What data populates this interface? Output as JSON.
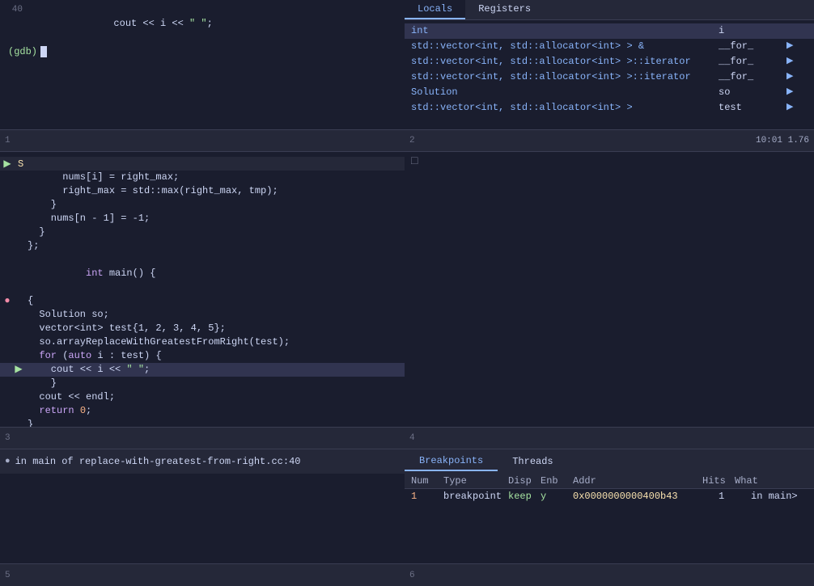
{
  "tabs": {
    "locals_label": "Locals",
    "registers_label": "Registers",
    "breakpoints_label": "Breakpoints",
    "threads_label": "Threads"
  },
  "top_left": {
    "lines": [
      {
        "num": "40",
        "content": "    cout << i << \" \";"
      },
      {
        "num": "",
        "content": "(gdb) "
      }
    ]
  },
  "locals": {
    "rows": [
      {
        "type": "int",
        "name": "i",
        "selected": true
      },
      {
        "type": "std::vector<int, std::allocator<int> > &",
        "name": "__for_"
      },
      {
        "type": "std::vector<int, std::allocator<int> >::iterator",
        "name": "__for_"
      },
      {
        "type": "std::vector<int, std::allocator<int> >::iterator",
        "name": "__for_"
      },
      {
        "type": "Solution",
        "name": "so"
      },
      {
        "type": "std::vector<int, std::allocator<int> >",
        "name": "test"
      }
    ]
  },
  "divider1": {
    "left_num": "1",
    "right_num": "2",
    "right_info": "10:01  1.76"
  },
  "source": {
    "lines": [
      {
        "num": "",
        "bp": false,
        "arrow": false,
        "exec_arrow": false,
        "content": "      nums[i] = right_max;",
        "highlight": false
      },
      {
        "num": "",
        "bp": false,
        "arrow": false,
        "exec_arrow": false,
        "content": "      right_max = std::max(right_max, tmp);",
        "highlight": false
      },
      {
        "num": "",
        "bp": false,
        "arrow": false,
        "exec_arrow": false,
        "content": "    }",
        "highlight": false
      },
      {
        "num": "",
        "bp": false,
        "arrow": false,
        "exec_arrow": false,
        "content": "    nums[n - 1] = -1;",
        "highlight": false
      },
      {
        "num": "",
        "bp": false,
        "arrow": false,
        "exec_arrow": false,
        "content": "  }",
        "highlight": false
      },
      {
        "num": "",
        "bp": false,
        "arrow": false,
        "exec_arrow": false,
        "content": "};",
        "highlight": false
      },
      {
        "num": "",
        "bp": false,
        "arrow": false,
        "exec_arrow": false,
        "content": "int main() {",
        "highlight": false
      },
      {
        "num": "",
        "bp": false,
        "arrow": false,
        "exec_arrow": false,
        "content": "  {",
        "highlight": false
      },
      {
        "num": "",
        "bp": false,
        "arrow": false,
        "exec_arrow": false,
        "content": "    Solution so;",
        "highlight": false
      },
      {
        "num": "",
        "bp": false,
        "arrow": false,
        "exec_arrow": false,
        "content": "    vector<int> test{1, 2, 3, 4, 5};",
        "highlight": false
      },
      {
        "num": "",
        "bp": false,
        "arrow": false,
        "exec_arrow": false,
        "content": "    so.arrayReplaceWithGreatestFromRight(test);",
        "highlight": false
      },
      {
        "num": "",
        "bp": false,
        "arrow": false,
        "exec_arrow": false,
        "content": "    for (auto i : test) {",
        "highlight": false
      },
      {
        "num": "",
        "bp": true,
        "arrow": true,
        "exec_arrow": false,
        "content": "      cout << i << \" \";",
        "highlight": true
      },
      {
        "num": "",
        "bp": false,
        "arrow": false,
        "exec_arrow": false,
        "content": "    }",
        "highlight": false
      },
      {
        "num": "",
        "bp": false,
        "arrow": false,
        "exec_arrow": false,
        "content": "  cout << endl;",
        "highlight": false
      },
      {
        "num": "",
        "bp": false,
        "arrow": false,
        "exec_arrow": false,
        "content": "  return 0;",
        "highlight": false
      },
      {
        "num": "",
        "bp": false,
        "arrow": false,
        "exec_arrow": false,
        "content": "  }",
        "highlight": false
      },
      {
        "num": "",
        "bp": false,
        "arrow": false,
        "exec_arrow": false,
        "content": "}",
        "highlight": false
      }
    ]
  },
  "divider2": {
    "left_num": "3",
    "right_num": "4"
  },
  "console": {
    "prompt_symbol": "(gdb)",
    "lines": [
      {
        "type": "info",
        "content": "0  in main of replace-with-greatest-from-right.cc:40"
      }
    ]
  },
  "breakpoints_table": {
    "headers": [
      "Num",
      "Type",
      "Disp",
      "Enb",
      "Addr",
      "Hits",
      "What"
    ],
    "rows": [
      {
        "num": "1",
        "type": "breakpoint",
        "disp": "keep",
        "enb": "y",
        "addr": "0x0000000000400b43",
        "hits": "1",
        "what": "in main>"
      }
    ]
  },
  "footer": {
    "left_num": "5",
    "right_num": "6"
  },
  "right_mid_num": "□"
}
